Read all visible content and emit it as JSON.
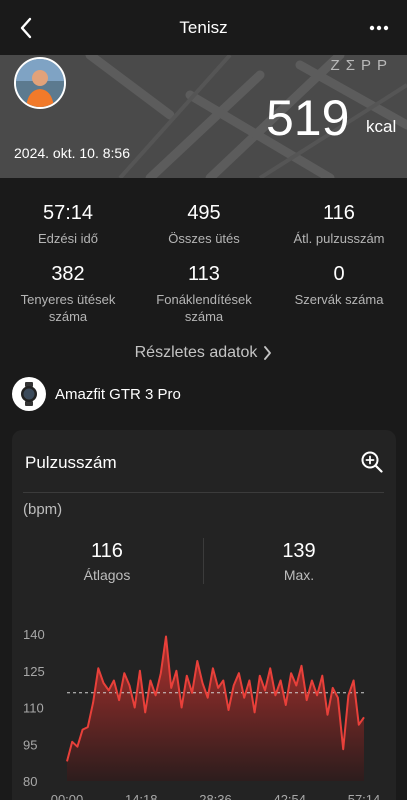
{
  "header": {
    "title": "Tenisz",
    "back_icon": "chevron-left-icon",
    "more_icon": "more-horizontal-icon"
  },
  "hero": {
    "brand": "ZΣPP",
    "calories_value": "519",
    "calories_unit": "kcal",
    "datetime": "2024. okt. 10. 8:56"
  },
  "stats": [
    {
      "value": "57:14",
      "label": "Edzési idő"
    },
    {
      "value": "495",
      "label": "Összes ütés"
    },
    {
      "value": "116",
      "label": "Átl. pulzusszám"
    },
    {
      "value": "382",
      "label": "Tenyeres ütések száma"
    },
    {
      "value": "113",
      "label": "Fonáklendítések száma"
    },
    {
      "value": "0",
      "label": "Szervák száma"
    }
  ],
  "details_link": "Részletes adatok",
  "device": {
    "name": "Amazfit GTR 3 Pro",
    "icon": "watch-icon"
  },
  "heart_rate_card": {
    "title": "Pulzusszám",
    "zoom_icon": "zoom-in-icon",
    "unit": "(bpm)",
    "average_value": "116",
    "average_label": "Átlagos",
    "max_value": "139",
    "max_label": "Max."
  },
  "colors": {
    "background": "#1a1a1a",
    "card": "#232323",
    "hero": "#4a4a4a",
    "series": "#e8403a"
  },
  "chart_data": {
    "type": "area",
    "ylabel": "(bpm)",
    "ylim": [
      80,
      140
    ],
    "yticks": [
      "140",
      "125",
      "110",
      "95",
      "80"
    ],
    "xticks": [
      "00:00",
      "14:18",
      "28:36",
      "42:54",
      "57:14"
    ],
    "reference_line": 116,
    "x_unit": "minutes",
    "x": [
      0,
      1,
      2,
      3,
      4,
      5,
      6,
      7,
      8,
      9,
      10,
      11,
      12,
      13,
      14,
      15,
      16,
      17,
      18,
      19,
      20,
      21,
      22,
      23,
      24,
      25,
      26,
      27,
      28,
      29,
      30,
      31,
      32,
      33,
      34,
      35,
      36,
      37,
      38,
      39,
      40,
      41,
      42,
      43,
      44,
      45,
      46,
      47,
      48,
      49,
      50,
      51,
      52,
      53,
      54,
      55,
      56,
      57
    ],
    "values": [
      88,
      96,
      94,
      101,
      102,
      112,
      126,
      120,
      117,
      121,
      113,
      124,
      119,
      110,
      125,
      108,
      121,
      115,
      124,
      139,
      118,
      125,
      110,
      123,
      116,
      129,
      120,
      114,
      126,
      118,
      121,
      109,
      119,
      124,
      114,
      121,
      108,
      123,
      117,
      126,
      115,
      121,
      111,
      124,
      119,
      127,
      113,
      121,
      115,
      123,
      107,
      118,
      114,
      93,
      115,
      121,
      103,
      106
    ]
  }
}
